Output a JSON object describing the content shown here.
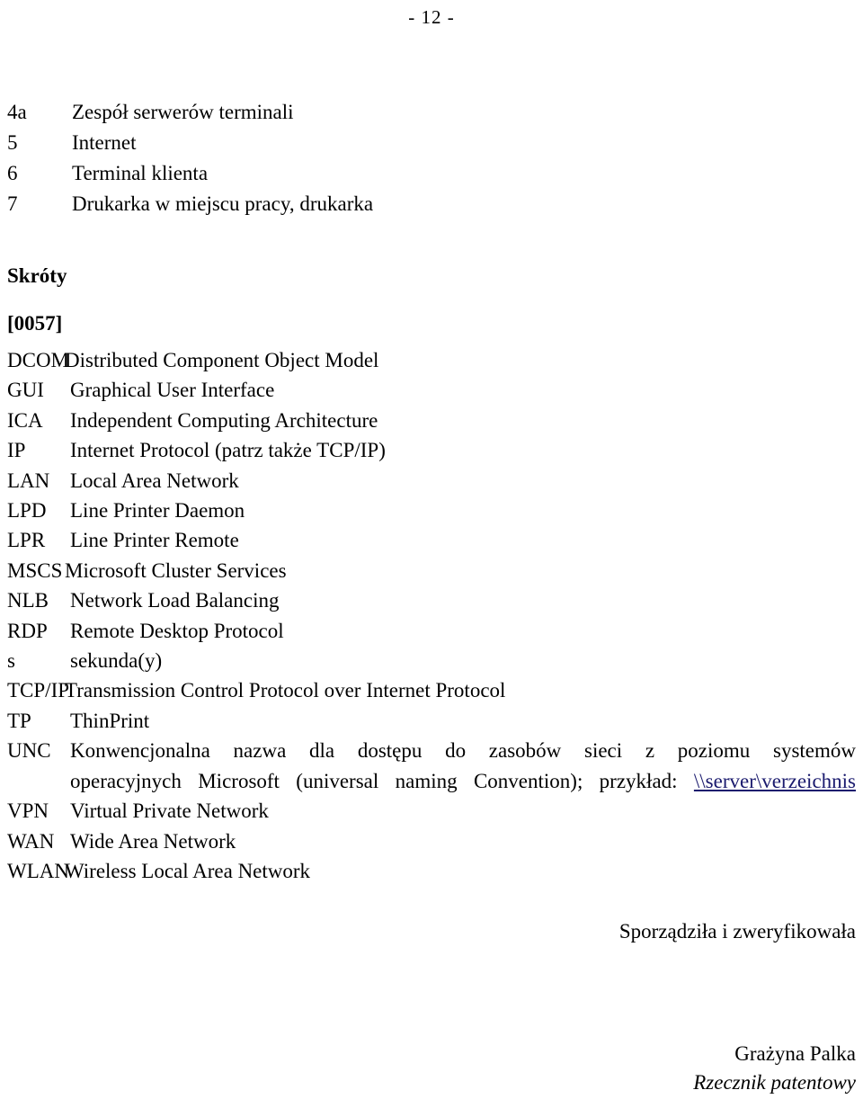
{
  "page": {
    "page_number": "- 12 -"
  },
  "legend": {
    "items": [
      {
        "num": "4a",
        "label": "Zespół serwerów terminali"
      },
      {
        "num": "5",
        "label": "Internet"
      },
      {
        "num": "6",
        "label": "Terminal klienta"
      },
      {
        "num": "7",
        "label": "Drukarka w miejscu pracy, drukarka"
      }
    ]
  },
  "sections": {
    "abbreviations_heading": "Skróty",
    "paragraph_marker": "[0057]"
  },
  "glossary": {
    "entries": [
      {
        "term": "DCOM",
        "definition": "Distributed Component Object Model"
      },
      {
        "term": "GUI",
        "definition": "Graphical User Interface"
      },
      {
        "term": "ICA",
        "definition": "Independent Computing Architecture"
      },
      {
        "term": "IP",
        "definition": "Internet Protocol (patrz także TCP/IP)"
      },
      {
        "term": "LAN",
        "definition": "Local Area Network"
      },
      {
        "term": "LPD",
        "definition": "Line Printer Daemon"
      },
      {
        "term": "LPR",
        "definition": "Line Printer Remote"
      },
      {
        "term": "MSCS",
        "definition": "Microsoft Cluster Services"
      },
      {
        "term": "NLB",
        "definition": "Network Load Balancing"
      },
      {
        "term": "RDP",
        "definition": "Remote Desktop Protocol"
      },
      {
        "term": "s",
        "definition": "sekunda(y)"
      },
      {
        "term": "TCP/IP",
        "definition": "Transmission Control Protocol over Internet Protocol"
      },
      {
        "term": "TP",
        "definition": "ThinPrint"
      },
      {
        "term": "VPN",
        "definition": "Virtual Private Network"
      },
      {
        "term": "WAN",
        "definition": "Wide Area Network"
      },
      {
        "term": "WLAN",
        "definition": "Wireless Local Area Network"
      }
    ],
    "unc": {
      "term": "UNC",
      "line1_a": "Konwencjonalna nazwa dla dostępu do zasobów sieci",
      "line1_b": "z poziomu",
      "line1_c": "systemów",
      "line2_text": "operacyjnych Microsoft (universal naming Convention); przykład:",
      "link_text": "\\\\server\\verzeichnis",
      "link_color": "#1a1a6e"
    }
  },
  "signature": {
    "prepared_by": "Sporządziła i zweryfikowała",
    "name": "Grażyna Palka",
    "title": "Rzecznik patentowy"
  }
}
